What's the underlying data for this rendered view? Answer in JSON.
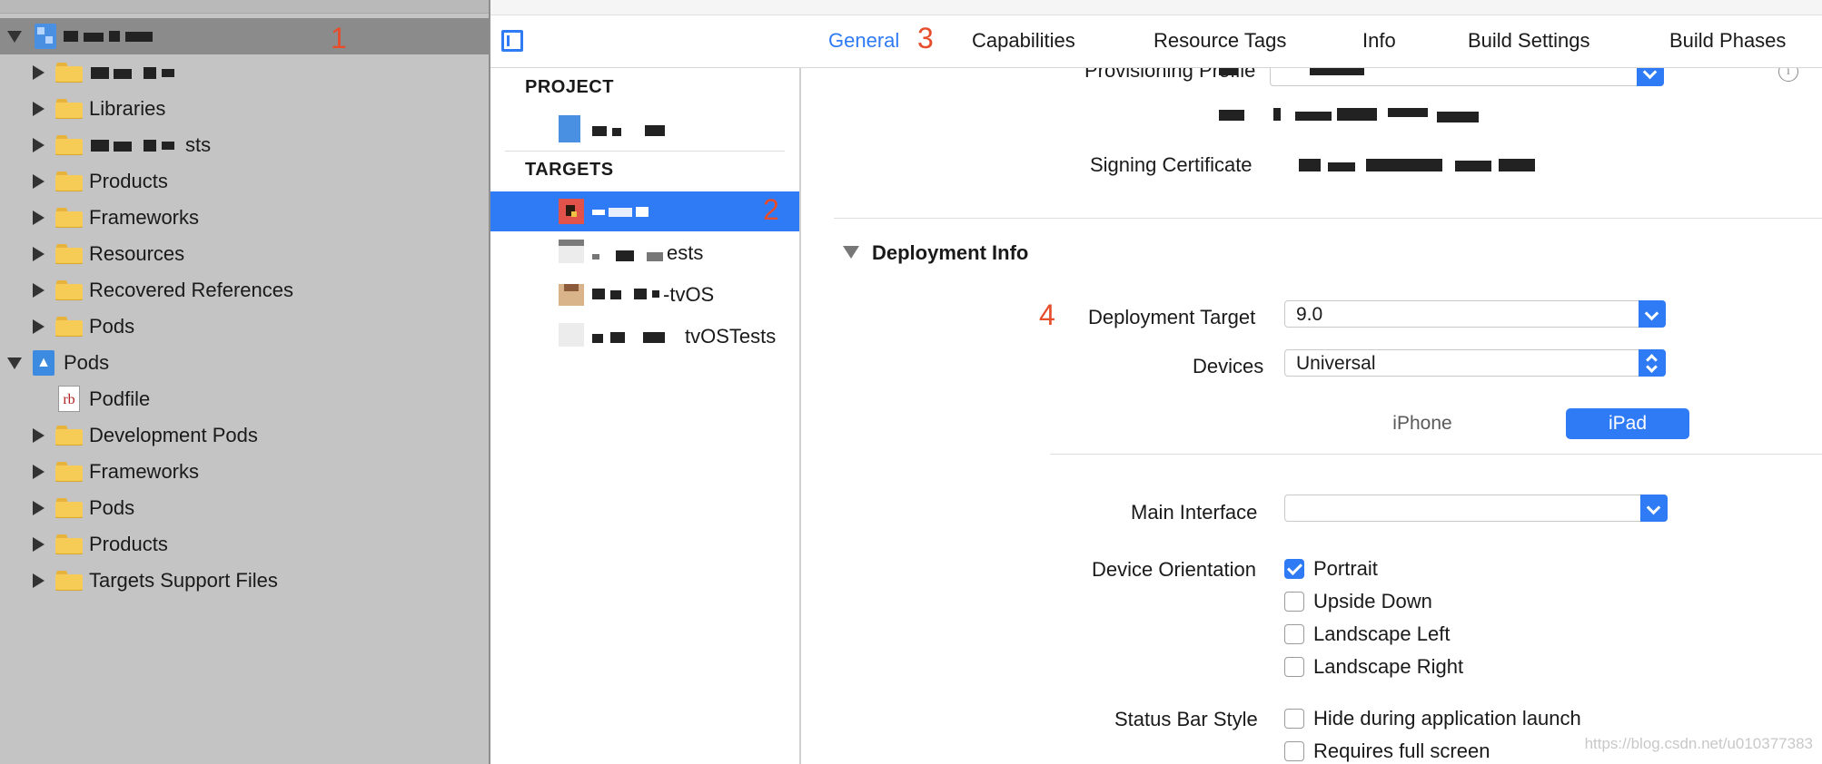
{
  "navigator": {
    "annotation": "1",
    "items": [
      {
        "label": "",
        "type": "project",
        "expanded": true,
        "selected": true
      },
      {
        "label": "",
        "type": "folder"
      },
      {
        "label": "Libraries",
        "type": "folder"
      },
      {
        "label": "sts",
        "type": "folder"
      },
      {
        "label": "Products",
        "type": "folder"
      },
      {
        "label": "Frameworks",
        "type": "folder"
      },
      {
        "label": "Resources",
        "type": "folder"
      },
      {
        "label": "Recovered References",
        "type": "folder"
      },
      {
        "label": "Pods",
        "type": "folder"
      },
      {
        "label": "Pods",
        "type": "pods-project",
        "expanded": true
      },
      {
        "label": "Podfile",
        "type": "ruby-file"
      },
      {
        "label": "Development Pods",
        "type": "folder"
      },
      {
        "label": "Frameworks",
        "type": "folder"
      },
      {
        "label": "Pods",
        "type": "folder"
      },
      {
        "label": "Products",
        "type": "folder"
      },
      {
        "label": "Targets Support Files",
        "type": "folder"
      }
    ]
  },
  "tabs": {
    "annotation": "3",
    "items": [
      "General",
      "Capabilities",
      "Resource Tags",
      "Info",
      "Build Settings",
      "Build Phases"
    ],
    "active": "General"
  },
  "target_list": {
    "annotation": "2",
    "project_header": "PROJECT",
    "targets_header": "TARGETS",
    "targets": [
      {
        "label": "",
        "selected": true
      },
      {
        "label": "ests"
      },
      {
        "label": "-tvOS"
      },
      {
        "label": "tvOSTests"
      }
    ]
  },
  "signing": {
    "provisioning_label": "Provisioning Profile",
    "certificate_label": "Signing Certificate"
  },
  "deployment": {
    "annotation": "4",
    "section_title": "Deployment Info",
    "target_label": "Deployment Target",
    "target_value": "9.0",
    "devices_label": "Devices",
    "devices_value": "Universal",
    "segments": [
      "iPhone",
      "iPad"
    ],
    "selected_segment": "iPad",
    "main_interface_label": "Main Interface",
    "main_interface_value": "",
    "orientation_label": "Device Orientation",
    "orientations": [
      {
        "label": "Portrait",
        "checked": true
      },
      {
        "label": "Upside Down",
        "checked": false
      },
      {
        "label": "Landscape Left",
        "checked": false
      },
      {
        "label": "Landscape Right",
        "checked": false
      }
    ],
    "status_bar_label": "Status Bar Style",
    "status_bar_options": [
      {
        "label": "Hide during application launch",
        "checked": false
      },
      {
        "label": "Requires full screen",
        "checked": false
      }
    ]
  },
  "watermark": "https://blog.csdn.net/u010377383",
  "colors": {
    "accent": "#2f7bf5",
    "annotation": "#e74c2b",
    "navigator_bg": "#c4c4c4",
    "folder": "#f7cc56"
  }
}
